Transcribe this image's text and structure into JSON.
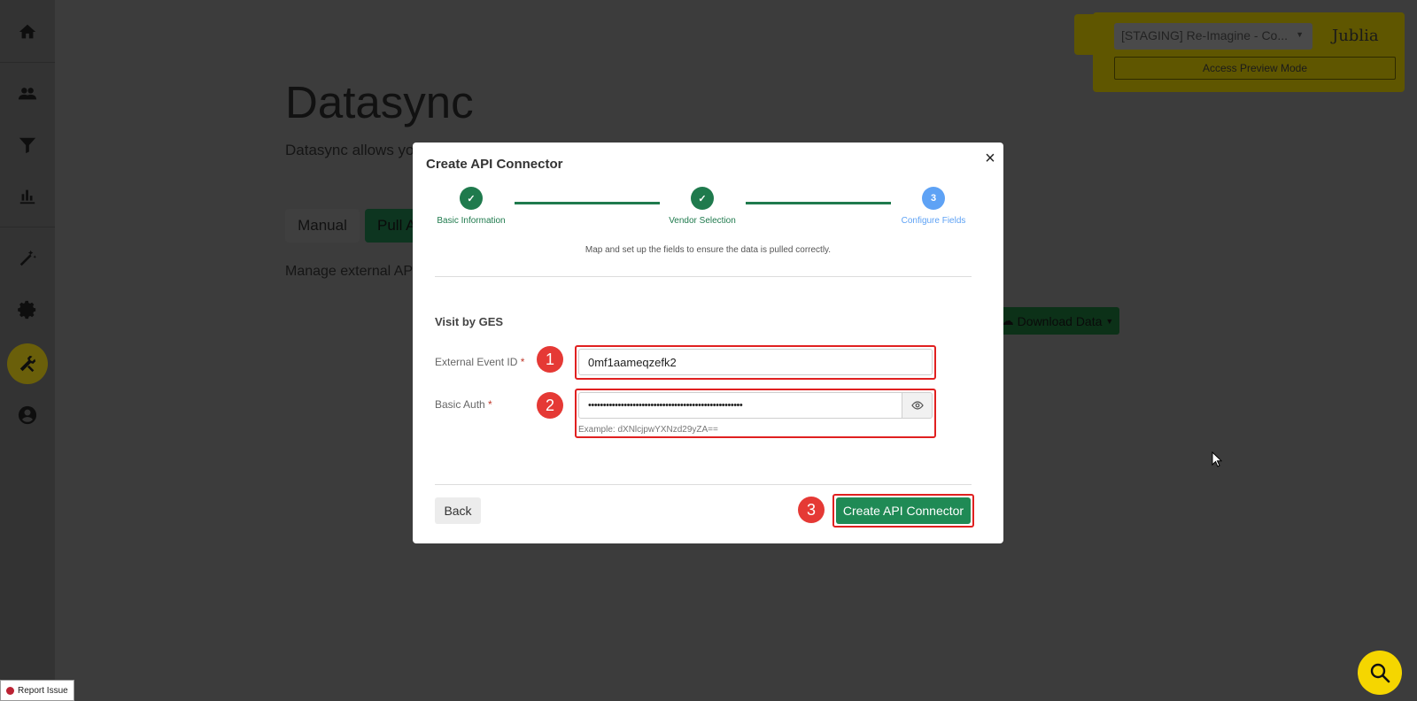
{
  "sidebar": {
    "items": [
      {
        "icon": "home-icon"
      },
      {
        "icon": "users-icon"
      },
      {
        "icon": "filter-icon"
      },
      {
        "icon": "bar-chart-icon"
      },
      {
        "icon": "magic-wand-icon"
      },
      {
        "icon": "gear-icon"
      },
      {
        "icon": "tools-icon",
        "active": true
      },
      {
        "icon": "user-circle-icon"
      }
    ]
  },
  "page": {
    "title": "Datasync",
    "subtitle": "Datasync allows yo",
    "tabs": {
      "manual": "Manual",
      "pull": "Pull A"
    },
    "manage_text": "Manage external AP",
    "download_label": "Download Data"
  },
  "preview": {
    "select_value": "[STAGING] Re-Imagine - Co...",
    "logo": "Jublia",
    "button_label": "Access Preview Mode"
  },
  "modal": {
    "title": "Create API Connector",
    "close_glyph": "×",
    "steps": [
      {
        "label": "Basic Information",
        "state": "done",
        "glyph": "✓"
      },
      {
        "label": "Vendor Selection",
        "state": "done",
        "glyph": "✓"
      },
      {
        "label": "Configure Fields",
        "state": "current",
        "glyph": "3"
      }
    ],
    "description": "Map and set up the fields to ensure the data is pulled correctly.",
    "section_title": "Visit by GES",
    "fields": {
      "event_id": {
        "label": "External Event ID",
        "required": "*",
        "value": "0mf1aameqzefk2"
      },
      "basic_auth": {
        "label": "Basic Auth",
        "required": "*",
        "value": "••••••••••••••••••••••••••••••••••••••••••••••••••••",
        "hint": "Example: dXNlcjpwYXNzd29yZA=="
      }
    },
    "badges": [
      "1",
      "2",
      "3"
    ],
    "back_label": "Back",
    "create_label": "Create API Connector"
  },
  "report_issue": "Report Issue",
  "colors": {
    "accent_green": "#1f8a55",
    "step_blue": "#5ea2f5",
    "highlight_red": "#e02020",
    "fab_yellow": "#f5d600"
  }
}
